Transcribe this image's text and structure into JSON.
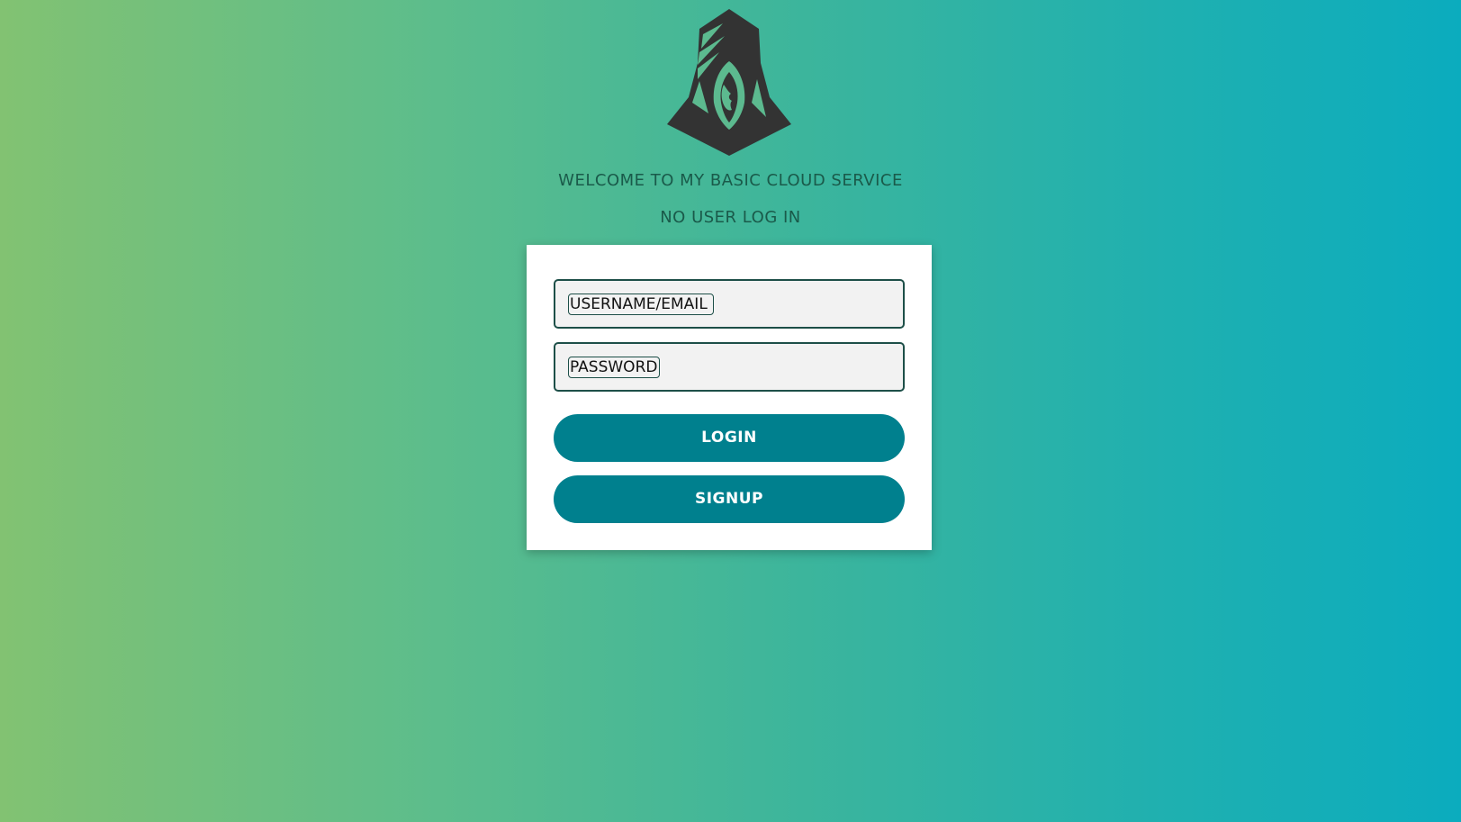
{
  "logo": {
    "icon": "hooded-figure-logo-icon",
    "color": "#333333"
  },
  "header": {
    "welcome": "WELCOME TO MY BASIC CLOUD SERVICE",
    "status": "NO USER LOG IN"
  },
  "form": {
    "username_placeholder": "USERNAME/EMAIL",
    "password_placeholder": "PASSWORD",
    "login_label": "LOGIN",
    "signup_label": "SIGNUP"
  },
  "colors": {
    "button": "#00808e",
    "heading": "#1a5a4a",
    "field_border": "#1d4f48",
    "gradient_start": "#82c272",
    "gradient_end": "#0bacbe"
  }
}
